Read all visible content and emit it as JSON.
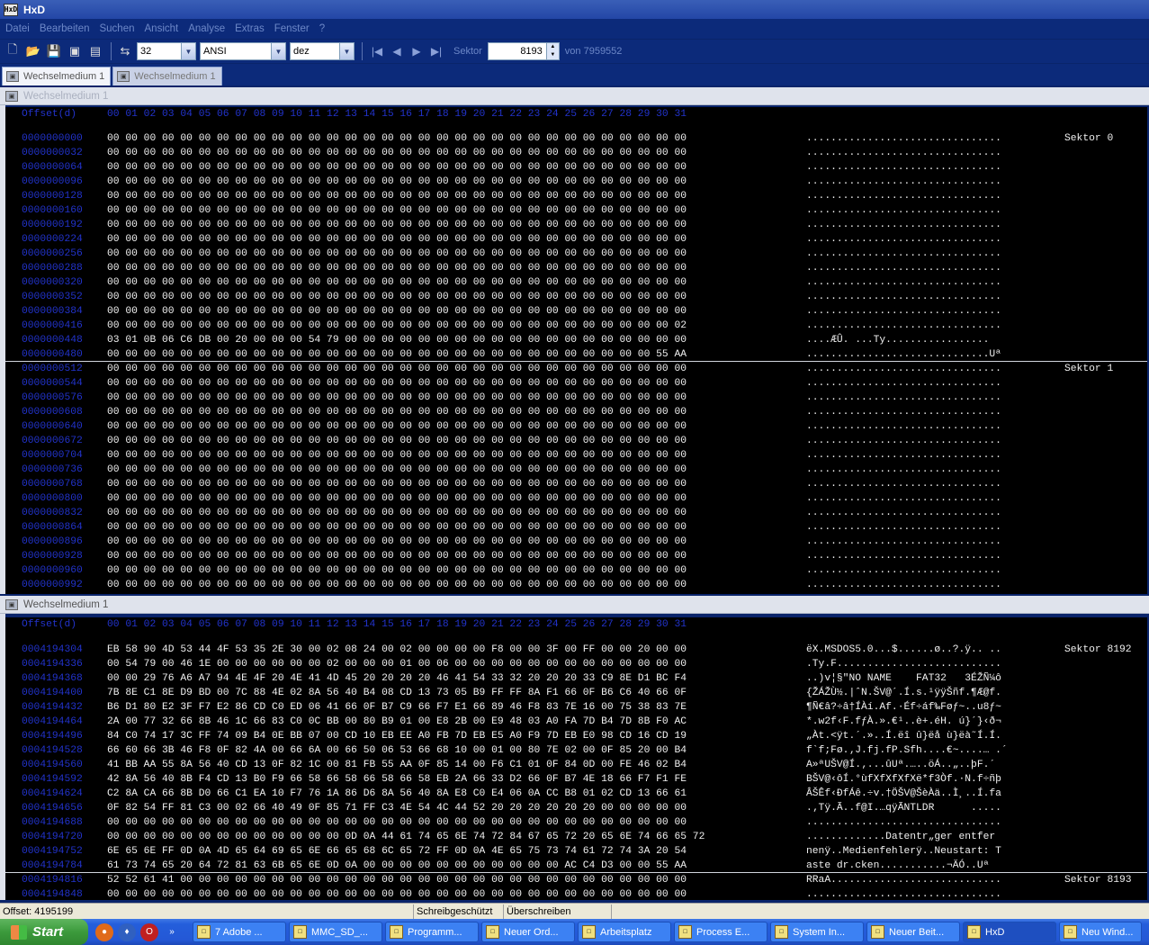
{
  "window": {
    "title": "HxD",
    "app_icon_text": "HxD"
  },
  "menu": [
    "Datei",
    "Bearbeiten",
    "Suchen",
    "Ansicht",
    "Analyse",
    "Extras",
    "Fenster",
    "?"
  ],
  "toolbar": {
    "bytes_per_row": "32",
    "charset": "ANSI",
    "offset_base": "dez",
    "sektor_label": "Sektor",
    "sektor_value": "8193",
    "von_label": "von 7959552"
  },
  "tabs": [
    {
      "label": "Wechselmedium 1",
      "active": true
    },
    {
      "label": "Wechselmedium 1",
      "active": false
    }
  ],
  "pane_top": {
    "title": "Wechselmedium 1",
    "header": {
      "offset_label": "Offset(d)",
      "columns": "00 01 02 03 04 05 06 07 08 09 10 11 12 13 14 15 16 17 18 19 20 21 22 23 24 25 26 27 28 29 30 31"
    },
    "rows": [
      {
        "off": "0000000000",
        "hex": "00 00 00 00 00 00 00 00 00 00 00 00 00 00 00 00 00 00 00 00 00 00 00 00 00 00 00 00 00 00 00 00",
        "asc": "................................",
        "sec": "Sektor 0"
      },
      {
        "off": "0000000032",
        "hex": "00 00 00 00 00 00 00 00 00 00 00 00 00 00 00 00 00 00 00 00 00 00 00 00 00 00 00 00 00 00 00 00",
        "asc": "................................",
        "sec": ""
      },
      {
        "off": "0000000064",
        "hex": "00 00 00 00 00 00 00 00 00 00 00 00 00 00 00 00 00 00 00 00 00 00 00 00 00 00 00 00 00 00 00 00",
        "asc": "................................",
        "sec": ""
      },
      {
        "off": "0000000096",
        "hex": "00 00 00 00 00 00 00 00 00 00 00 00 00 00 00 00 00 00 00 00 00 00 00 00 00 00 00 00 00 00 00 00",
        "asc": "................................",
        "sec": ""
      },
      {
        "off": "0000000128",
        "hex": "00 00 00 00 00 00 00 00 00 00 00 00 00 00 00 00 00 00 00 00 00 00 00 00 00 00 00 00 00 00 00 00",
        "asc": "................................",
        "sec": ""
      },
      {
        "off": "0000000160",
        "hex": "00 00 00 00 00 00 00 00 00 00 00 00 00 00 00 00 00 00 00 00 00 00 00 00 00 00 00 00 00 00 00 00",
        "asc": "................................",
        "sec": ""
      },
      {
        "off": "0000000192",
        "hex": "00 00 00 00 00 00 00 00 00 00 00 00 00 00 00 00 00 00 00 00 00 00 00 00 00 00 00 00 00 00 00 00",
        "asc": "................................",
        "sec": ""
      },
      {
        "off": "0000000224",
        "hex": "00 00 00 00 00 00 00 00 00 00 00 00 00 00 00 00 00 00 00 00 00 00 00 00 00 00 00 00 00 00 00 00",
        "asc": "................................",
        "sec": ""
      },
      {
        "off": "0000000256",
        "hex": "00 00 00 00 00 00 00 00 00 00 00 00 00 00 00 00 00 00 00 00 00 00 00 00 00 00 00 00 00 00 00 00",
        "asc": "................................",
        "sec": ""
      },
      {
        "off": "0000000288",
        "hex": "00 00 00 00 00 00 00 00 00 00 00 00 00 00 00 00 00 00 00 00 00 00 00 00 00 00 00 00 00 00 00 00",
        "asc": "................................",
        "sec": ""
      },
      {
        "off": "0000000320",
        "hex": "00 00 00 00 00 00 00 00 00 00 00 00 00 00 00 00 00 00 00 00 00 00 00 00 00 00 00 00 00 00 00 00",
        "asc": "................................",
        "sec": ""
      },
      {
        "off": "0000000352",
        "hex": "00 00 00 00 00 00 00 00 00 00 00 00 00 00 00 00 00 00 00 00 00 00 00 00 00 00 00 00 00 00 00 00",
        "asc": "................................",
        "sec": ""
      },
      {
        "off": "0000000384",
        "hex": "00 00 00 00 00 00 00 00 00 00 00 00 00 00 00 00 00 00 00 00 00 00 00 00 00 00 00 00 00 00 00 00",
        "asc": "................................",
        "sec": ""
      },
      {
        "off": "0000000416",
        "hex": "00 00 00 00 00 00 00 00 00 00 00 00 00 00 00 00 00 00 00 00 00 00 00 00 00 00 00 00 00 00 00 02",
        "asc": "................................",
        "sec": ""
      },
      {
        "off": "0000000448",
        "hex": "03 01 0B 06 C6 DB 00 20 00 00 00 54 79 00 00 00 00 00 00 00 00 00 00 00 00 00 00 00 00 00 00 00",
        "asc": "....ÆÛ. ...Ty.................",
        "sec": ""
      },
      {
        "off": "0000000480",
        "hex": "00 00 00 00 00 00 00 00 00 00 00 00 00 00 00 00 00 00 00 00 00 00 00 00 00 00 00 00 00 00 55 AA",
        "asc": "..............................Uª",
        "sec": ""
      },
      {
        "off": "0000000512",
        "hex": "00 00 00 00 00 00 00 00 00 00 00 00 00 00 00 00 00 00 00 00 00 00 00 00 00 00 00 00 00 00 00 00",
        "asc": "................................",
        "sec": "Sektor 1"
      },
      {
        "off": "0000000544",
        "hex": "00 00 00 00 00 00 00 00 00 00 00 00 00 00 00 00 00 00 00 00 00 00 00 00 00 00 00 00 00 00 00 00",
        "asc": "................................",
        "sec": ""
      },
      {
        "off": "0000000576",
        "hex": "00 00 00 00 00 00 00 00 00 00 00 00 00 00 00 00 00 00 00 00 00 00 00 00 00 00 00 00 00 00 00 00",
        "asc": "................................",
        "sec": ""
      },
      {
        "off": "0000000608",
        "hex": "00 00 00 00 00 00 00 00 00 00 00 00 00 00 00 00 00 00 00 00 00 00 00 00 00 00 00 00 00 00 00 00",
        "asc": "................................",
        "sec": ""
      },
      {
        "off": "0000000640",
        "hex": "00 00 00 00 00 00 00 00 00 00 00 00 00 00 00 00 00 00 00 00 00 00 00 00 00 00 00 00 00 00 00 00",
        "asc": "................................",
        "sec": ""
      },
      {
        "off": "0000000672",
        "hex": "00 00 00 00 00 00 00 00 00 00 00 00 00 00 00 00 00 00 00 00 00 00 00 00 00 00 00 00 00 00 00 00",
        "asc": "................................",
        "sec": ""
      },
      {
        "off": "0000000704",
        "hex": "00 00 00 00 00 00 00 00 00 00 00 00 00 00 00 00 00 00 00 00 00 00 00 00 00 00 00 00 00 00 00 00",
        "asc": "................................",
        "sec": ""
      },
      {
        "off": "0000000736",
        "hex": "00 00 00 00 00 00 00 00 00 00 00 00 00 00 00 00 00 00 00 00 00 00 00 00 00 00 00 00 00 00 00 00",
        "asc": "................................",
        "sec": ""
      },
      {
        "off": "0000000768",
        "hex": "00 00 00 00 00 00 00 00 00 00 00 00 00 00 00 00 00 00 00 00 00 00 00 00 00 00 00 00 00 00 00 00",
        "asc": "................................",
        "sec": ""
      },
      {
        "off": "0000000800",
        "hex": "00 00 00 00 00 00 00 00 00 00 00 00 00 00 00 00 00 00 00 00 00 00 00 00 00 00 00 00 00 00 00 00",
        "asc": "................................",
        "sec": ""
      },
      {
        "off": "0000000832",
        "hex": "00 00 00 00 00 00 00 00 00 00 00 00 00 00 00 00 00 00 00 00 00 00 00 00 00 00 00 00 00 00 00 00",
        "asc": "................................",
        "sec": ""
      },
      {
        "off": "0000000864",
        "hex": "00 00 00 00 00 00 00 00 00 00 00 00 00 00 00 00 00 00 00 00 00 00 00 00 00 00 00 00 00 00 00 00",
        "asc": "................................",
        "sec": ""
      },
      {
        "off": "0000000896",
        "hex": "00 00 00 00 00 00 00 00 00 00 00 00 00 00 00 00 00 00 00 00 00 00 00 00 00 00 00 00 00 00 00 00",
        "asc": "................................",
        "sec": ""
      },
      {
        "off": "0000000928",
        "hex": "00 00 00 00 00 00 00 00 00 00 00 00 00 00 00 00 00 00 00 00 00 00 00 00 00 00 00 00 00 00 00 00",
        "asc": "................................",
        "sec": ""
      },
      {
        "off": "0000000960",
        "hex": "00 00 00 00 00 00 00 00 00 00 00 00 00 00 00 00 00 00 00 00 00 00 00 00 00 00 00 00 00 00 00 00",
        "asc": "................................",
        "sec": ""
      },
      {
        "off": "0000000992",
        "hex": "00 00 00 00 00 00 00 00 00 00 00 00 00 00 00 00 00 00 00 00 00 00 00 00 00 00 00 00 00 00 00 00",
        "asc": "................................",
        "sec": ""
      }
    ]
  },
  "pane_bottom": {
    "title": "Wechselmedium 1",
    "header": {
      "offset_label": "Offset(d)",
      "columns": "00 01 02 03 04 05 06 07 08 09 10 11 12 13 14 15 16 17 18 19 20 21 22 23 24 25 26 27 28 29 30 31"
    },
    "rows": [
      {
        "off": "0004194304",
        "hex": "EB 58 90 4D 53 44 4F 53 35 2E 30 00 02 08 24 00 02 00 00 00 00 F8 00 00 3F 00 FF 00 00 20 00 00",
        "asc": "ëX.MSDOS5.0...$......ø..?.ÿ.. ..",
        "sec": "Sektor 8192"
      },
      {
        "off": "0004194336",
        "hex": "00 54 79 00 46 1E 00 00 00 00 00 00 02 00 00 00 01 00 06 00 00 00 00 00 00 00 00 00 00 00 00 00",
        "asc": ".Ty.F...........................",
        "sec": ""
      },
      {
        "off": "0004194368",
        "hex": "00 00 29 76 A6 A7 94 4E 4F 20 4E 41 4D 45 20 20 20 20 46 41 54 33 32 20 20 20 33 C9 8E D1 BC F4",
        "asc": "..)v¦§\"NO NAME    FAT32   3ÉŽÑ¼ô",
        "sec": ""
      },
      {
        "off": "0004194400",
        "hex": "7B 8E C1 8E D9 BD 00 7C 88 4E 02 8A 56 40 B4 08 CD 13 73 05 B9 FF FF 8A F1 66 0F B6 C6 40 66 0F",
        "asc": "{ŽÁŽÙ½.|ˆN.ŠV@´.Í.s.¹ÿÿŠñf.¶Æ@f.",
        "sec": ""
      },
      {
        "off": "0004194432",
        "hex": "B6 D1 80 E2 3F F7 E2 86 CD C0 ED 06 41 66 0F B7 C9 66 F7 E1 66 89 46 F8 83 7E 16 00 75 38 83 7E",
        "asc": "¶Ñ€â?÷â†ÍÀí.Af.·Éf÷áf‰Føƒ~..u8ƒ~",
        "sec": ""
      },
      {
        "off": "0004194464",
        "hex": "2A 00 77 32 66 8B 46 1C 66 83 C0 0C BB 00 80 B9 01 00 E8 2B 00 E9 48 03 A0 FA 7D B4 7D 8B F0 AC",
        "asc": "*.w2f‹F.fƒÀ.».€¹..è+.éH. ú}´}‹ð¬",
        "sec": ""
      },
      {
        "off": "0004194496",
        "hex": "84 C0 74 17 3C FF 74 09 B4 0E BB 07 00 CD 10 EB EE A0 FB 7D EB E5 A0 F9 7D EB E0 98 CD 16 CD 19",
        "asc": "„Àt.<ÿt.´.»..Í.ëî û}ëå ù}ëà˜Í.Í.",
        "sec": ""
      },
      {
        "off": "0004194528",
        "hex": "66 60 66 3B 46 F8 0F 82 4A 00 66 6A 00 66 50 06 53 66 68 10 00 01 00 80 7E 02 00 0F 85 20 00 B4",
        "asc": "f`f;Fø.‚J.fj.fP.Sfh....€~....… .´",
        "sec": ""
      },
      {
        "off": "0004194560",
        "hex": "41 BB AA 55 8A 56 40 CD 13 0F 82 1C 00 81 FB 55 AA 0F 85 14 00 F6 C1 01 0F 84 0D 00 FE 46 02 B4",
        "asc": "A»ªUŠV@Í.‚...ûUª.…..öÁ..„..þF.´",
        "sec": ""
      },
      {
        "off": "0004194592",
        "hex": "42 8A 56 40 8B F4 CD 13 B0 F9 66 58 66 58 66 58 66 58 EB 2A 66 33 D2 66 0F B7 4E 18 66 F7 F1 FE",
        "asc": "BŠV@‹ôÍ.°ùfXfXfXfXë*f3Òf.·N.f÷ñþ",
        "sec": ""
      },
      {
        "off": "0004194624",
        "hex": "C2 8A CA 66 8B D0 66 C1 EA 10 F7 76 1A 86 D6 8A 56 40 8A E8 C0 E4 06 0A CC B8 01 02 CD 13 66 61",
        "asc": "ÂŠÊf‹ÐfÁê.÷v.†ÖŠV@ŠèÀä..Ì¸..Í.fa",
        "sec": ""
      },
      {
        "off": "0004194656",
        "hex": "0F 82 54 FF 81 C3 00 02 66 40 49 0F 85 71 FF C3 4E 54 4C 44 52 20 20 20 20 20 20 00 00 00 00 00",
        "asc": ".‚Tÿ.Ã..f@I.…qÿÃNTLDR      .....",
        "sec": ""
      },
      {
        "off": "0004194688",
        "hex": "00 00 00 00 00 00 00 00 00 00 00 00 00 00 00 00 00 00 00 00 00 00 00 00 00 00 00 00 00 00 00 00",
        "asc": "................................",
        "sec": ""
      },
      {
        "off": "0004194720",
        "hex": "00 00 00 00 00 00 00 00 00 00 00 00 00 0D 0A 44 61 74 65 6E 74 72 84 67 65 72 20 65 6E 74 66 65 72",
        "asc": ".............Datentr„ger entfer",
        "sec": ""
      },
      {
        "off": "0004194752",
        "hex": "6E 65 6E FF 0D 0A 4D 65 64 69 65 6E 66 65 68 6C 65 72 FF 0D 0A 4E 65 75 73 74 61 72 74 3A 20 54",
        "asc": "nenÿ..Medienfehlerÿ..Neustart: T",
        "sec": ""
      },
      {
        "off": "0004194784",
        "hex": "61 73 74 65 20 64 72 81 63 6B 65 6E 0D 0A 00 00 00 00 00 00 00 00 00 00 00 AC C4 D3 00 00 55 AA",
        "asc": "aste dr.cken...........¬ÄÓ..Uª",
        "sec": ""
      },
      {
        "off": "0004194816",
        "hex": "52 52 61 41 00 00 00 00 00 00 00 00 00 00 00 00 00 00 00 00 00 00 00 00 00 00 00 00 00 00 00 00",
        "asc": "RRaA............................",
        "sec": "Sektor 8193"
      },
      {
        "off": "0004194848",
        "hex": "00 00 00 00 00 00 00 00 00 00 00 00 00 00 00 00 00 00 00 00 00 00 00 00 00 00 00 00 00 00 00 00",
        "asc": "................................",
        "sec": ""
      }
    ]
  },
  "status": {
    "offset": "Offset: 4195199",
    "write_protect": "Schreibgeschützt",
    "mode": "Überschreiben"
  },
  "taskbar": {
    "start": "Start",
    "tasks": [
      {
        "label": "7 Adobe ...",
        "active": false
      },
      {
        "label": "MMC_SD_...",
        "active": false
      },
      {
        "label": "Programm...",
        "active": false
      },
      {
        "label": "Neuer Ord...",
        "active": false
      },
      {
        "label": "Arbeitsplatz",
        "active": false
      },
      {
        "label": "Process E...",
        "active": false
      },
      {
        "label": "System In...",
        "active": false
      },
      {
        "label": "Neuer Beit...",
        "active": false
      },
      {
        "label": "HxD",
        "active": true
      },
      {
        "label": "Neu Wind...",
        "active": false
      }
    ]
  },
  "colors": {
    "offset_blue": "#2233cc",
    "hex_bg": "#000000",
    "title_blue": "#2346a6"
  }
}
